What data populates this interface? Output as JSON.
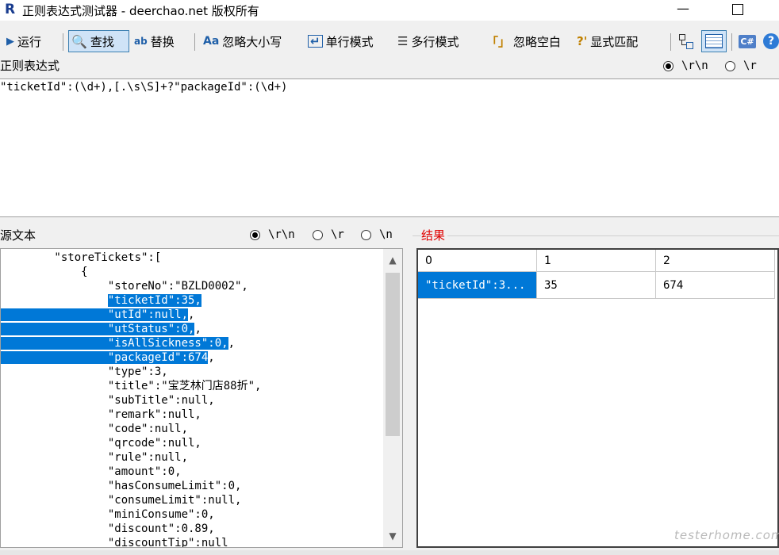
{
  "window": {
    "title": "正则表达式测试器 - deerchao.net 版权所有",
    "app_icon": "R",
    "minimize": "—"
  },
  "toolbar": {
    "run": "运行",
    "find": "查找",
    "replace": "替换",
    "ignore_case": "忽略大小写",
    "single_line": "单行模式",
    "multi_line": "多行模式",
    "ignore_whitespace": "忽略空白",
    "explicit_capture": "显式匹配",
    "ignore_whitespace_icon": "「」",
    "explicit_capture_icon": "?'",
    "csharp_icon": "C#",
    "help_icon": "?"
  },
  "regex": {
    "label": "正则表达式",
    "pattern": "\"ticketId\":(\\d+),[.\\s\\S]+?\"packageId\":(\\d+)",
    "newline_options": [
      "\\r\\n",
      "\\r"
    ],
    "selected_newline": 0
  },
  "source": {
    "label": "源文本",
    "newline_options": [
      "\\r\\n",
      "\\r",
      "\\n"
    ],
    "selected_newline": 0,
    "lines": [
      "        \"storeTickets\":[",
      "            {",
      "                \"storeNo\":\"BZLD0002\",",
      "                \"ticketId\":35,",
      "                \"utId\":null,",
      "                \"utStatus\":0,",
      "                \"isAllSickness\":0,",
      "                \"packageId\":674",
      "                \"type\":3,",
      "                \"title\":\"宝芝林门店88折\",",
      "                \"subTitle\":null,",
      "                \"remark\":null,",
      "                \"code\":null,",
      "                \"qrcode\":null,",
      "                \"rule\":null,",
      "                \"amount\":0,",
      "                \"hasConsumeLimit\":0,",
      "                \"consumeLimit\":null,",
      "                \"miniConsume\":0,",
      "                \"discount\":0.89,",
      "                \"discountTip\":null"
    ],
    "line_tails": [
      "",
      "",
      "",
      "",
      ",",
      ",",
      ",",
      ",",
      "",
      "",
      "",
      "",
      "",
      "",
      "",
      "",
      "",
      "",
      "",
      "",
      ""
    ]
  },
  "results": {
    "label": "结果",
    "headers": [
      "0",
      "1",
      "2"
    ],
    "rows": [
      [
        "\"ticketId\":3...",
        "35",
        "674"
      ]
    ]
  },
  "watermark": "testerhome.com"
}
